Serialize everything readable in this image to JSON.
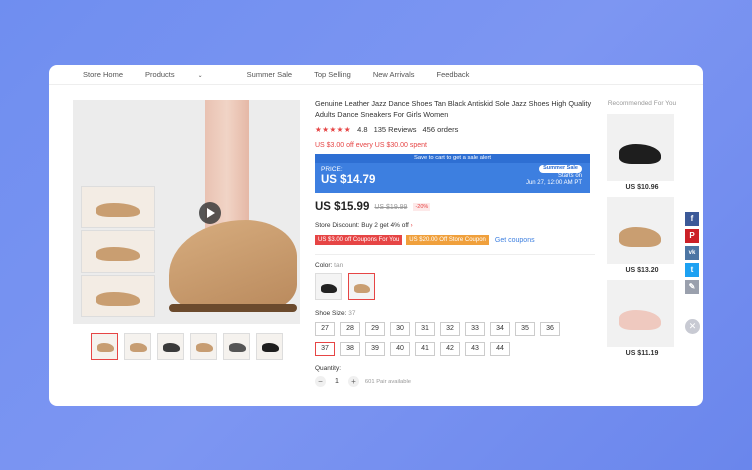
{
  "nav": {
    "items": [
      "Store Home",
      "Products",
      "Summer Sale",
      "Top Selling",
      "New Arrivals",
      "Feedback"
    ]
  },
  "product": {
    "title": "Genuine Leather Jazz Dance Shoes Tan Black Antiskid Sole Jazz Shoes High Quality Adults Dance Sneakers For Girls Women",
    "stars": "★★★★★",
    "rating": "4.8",
    "reviews": "135 Reviews",
    "orders": "456 orders",
    "coupon_text": "US $3.00 off every US $30.00 spent",
    "sale": {
      "top": "Save to cart to get a sale alert",
      "price_label": "PRICE:",
      "price": "US $14.79",
      "badge": "Summer Sale",
      "starts_on": "Starts on",
      "date": "Jun 27, 12:00 AM PT"
    },
    "price": "US $15.99",
    "old_price": "US $19.99",
    "discount": "-20%",
    "store_discount": "Store Discount: Buy 2 get 4% off",
    "store_discount_arrow": "›",
    "coupons": [
      "US $3.00 off Coupons For You",
      "US $20.00 Off Store Coupon"
    ],
    "get_coupons": "Get coupons",
    "color_label": "Color:",
    "color_value": "tan",
    "colors": [
      "#222222",
      "#c99e71"
    ],
    "size_label": "Shoe Size:",
    "size_value": "37",
    "sizes": [
      "27",
      "28",
      "29",
      "30",
      "31",
      "32",
      "33",
      "34",
      "35",
      "36",
      "37",
      "38",
      "39",
      "40",
      "41",
      "42",
      "43",
      "44"
    ],
    "selected_size": "37",
    "quantity_label": "Quantity:",
    "quantity": "1",
    "minus": "−",
    "plus": "+",
    "available": "601 Pair available",
    "accent": "#e64545",
    "sale_color": "#3d7fe0"
  },
  "recommended": {
    "title": "Recommended For You",
    "items": [
      {
        "price": "US $10.96",
        "color": "#1e1e1e"
      },
      {
        "price": "US $13.20",
        "color": "#c99e71"
      },
      {
        "price": "US $11.19",
        "color": "#efc9bf"
      }
    ]
  },
  "share": {
    "icons": [
      {
        "name": "facebook-icon",
        "glyph": "f",
        "color": "#3b5998"
      },
      {
        "name": "pinterest-icon",
        "glyph": "P",
        "color": "#cb2027"
      },
      {
        "name": "vk-icon",
        "glyph": "vk",
        "color": "#4c75a3"
      },
      {
        "name": "twitter-icon",
        "glyph": "t",
        "color": "#1da1f2"
      },
      {
        "name": "edit-icon",
        "glyph": "✎",
        "color": "#9aa0ad"
      }
    ],
    "close": "✕"
  }
}
